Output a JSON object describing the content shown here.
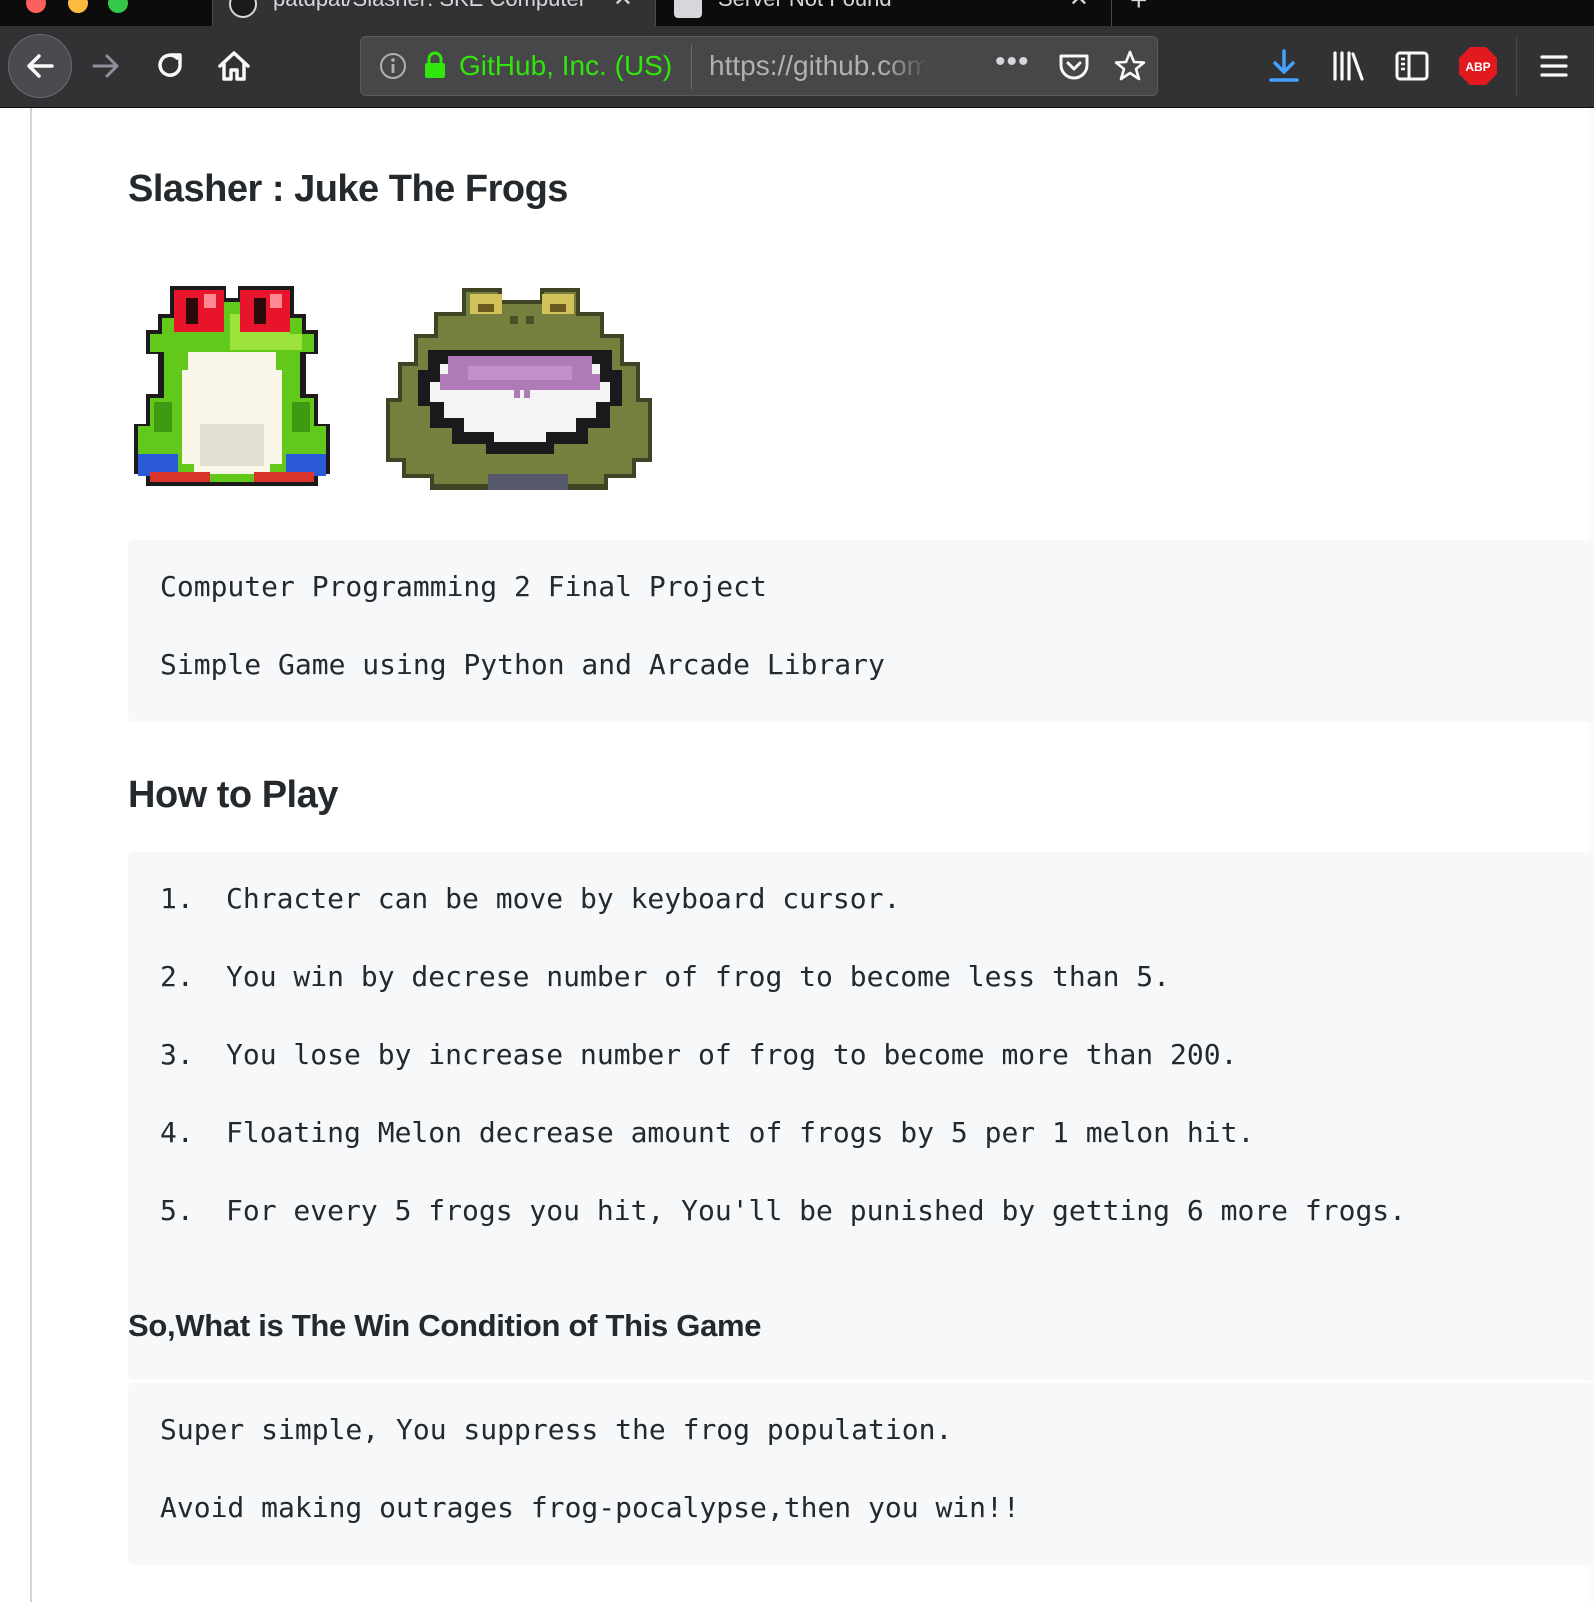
{
  "browser": {
    "tabs": [
      {
        "title": "patdpat/Slasher: SKE Computer",
        "active": true
      },
      {
        "title": "Server Not Found",
        "active": false
      }
    ],
    "new_tab_label": "+",
    "close_glyph": "✕",
    "urlbar": {
      "org_identity": "GitHub, Inc. (US)",
      "url": "https://github.com",
      "more_glyph": "•••"
    },
    "abp_label": "ABP",
    "colors": {
      "toolbar": "#323234",
      "secure_green": "#30e60b",
      "download_blue": "#45a1ff",
      "abp_red": "#e21a1f"
    },
    "icons": [
      "back-icon",
      "forward-icon",
      "reload-icon",
      "home-icon",
      "info-icon",
      "lock-icon",
      "page-actions-icon",
      "pocket-icon",
      "bookmark-star-icon",
      "download-icon",
      "library-icon",
      "sidebar-icon",
      "adblock-plus-icon",
      "hamburger-menu-icon"
    ]
  },
  "readme": {
    "title": "Slasher : Juke The Frogs",
    "intro_block": [
      "Computer Programming 2 Final Project",
      "Simple Game using Python and Arcade Library"
    ],
    "how_to_play_heading": "How to Play",
    "rules": [
      {
        "num": "1.",
        "text": "Chracter can be move by keyboard cursor."
      },
      {
        "num": "2.",
        "text": "You win by decrese number of frog to become less than 5."
      },
      {
        "num": "3.",
        "text": "You lose by increase number of frog to become more than 200."
      },
      {
        "num": "4.",
        "text": "Floating Melon decrease amount of frogs by 5 per 1 melon hit."
      },
      {
        "num": "5.",
        "text": "For every 5 frogs you hit, You'll be punished by getting 6 more frogs."
      }
    ],
    "win_heading": "So,What is The Win Condition of This Game",
    "win_block": [
      "Super simple, You suppress the frog population.",
      "Avoid making outrages frog-pocalypse,then you win!!"
    ]
  }
}
